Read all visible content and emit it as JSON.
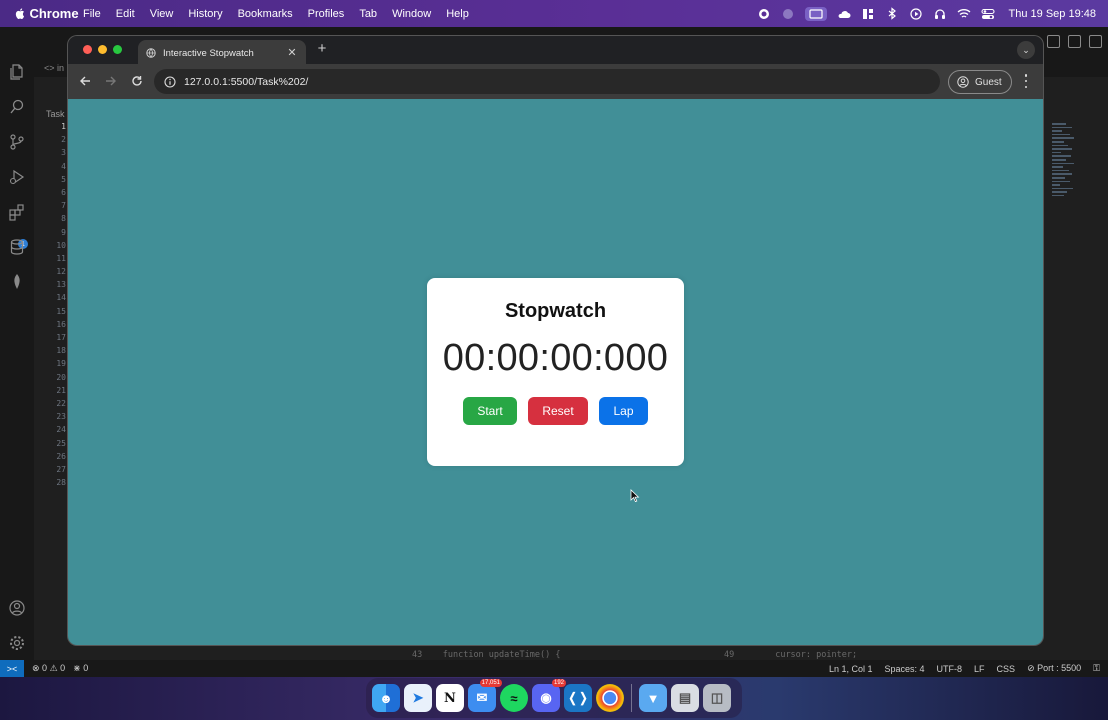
{
  "menubar": {
    "items": [
      "Chrome",
      "File",
      "Edit",
      "View",
      "History",
      "Bookmarks",
      "Profiles",
      "Tab",
      "Window",
      "Help"
    ],
    "clock": "Thu 19 Sep  19:48"
  },
  "vscode": {
    "tab_label": "in",
    "explorer_label": "Task",
    "line_numbers": [
      "1",
      "2",
      "3",
      "4",
      "5",
      "6",
      "7",
      "8",
      "9",
      "10",
      "11",
      "12",
      "13",
      "14",
      "15",
      "16",
      "17",
      "18",
      "19",
      "20",
      "21",
      "22",
      "23",
      "24",
      "25",
      "26",
      "27",
      "28"
    ],
    "code_left_line": "43",
    "code_left": "function updateTime() {",
    "code_right_line": "49",
    "code_right": "cursor: pointer;",
    "status": {
      "problems": "0",
      "warnings": "0",
      "ports_count": "0",
      "position": "Ln 1, Col 1",
      "spaces": "Spaces: 4",
      "encoding": "UTF-8",
      "eol": "LF",
      "language": "CSS",
      "port": "Port : 5500"
    }
  },
  "browser": {
    "tab_title": "Interactive Stopwatch",
    "url": "127.0.0.1:5500/Task%202/",
    "profile": "Guest"
  },
  "stopwatch": {
    "title": "Stopwatch",
    "time": "00:00:00:000",
    "start_label": "Start",
    "reset_label": "Reset",
    "lap_label": "Lap"
  },
  "dock": {
    "mail_badge": "17,051",
    "discord_badge": "192"
  },
  "colors": {
    "page_bg": "#418f97",
    "start": "#28a745",
    "reset": "#d6303f",
    "lap": "#0b72e8"
  }
}
